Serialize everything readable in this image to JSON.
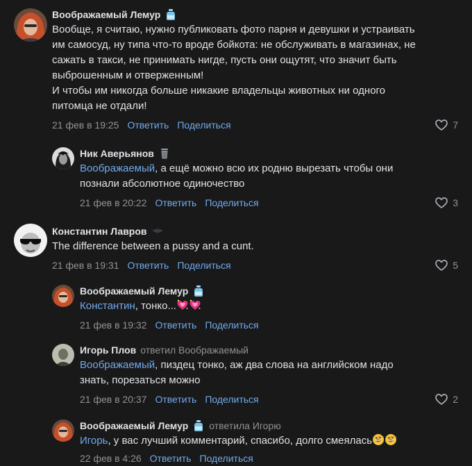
{
  "comments": [
    {
      "author": "Воображаемый Лемур",
      "lines": [
        "Вообще, я считаю, нужно публиковать фото парня и девушки и устраивать",
        "им самосуд, ну типа что-то вроде бойкота: не обслуживать в магазинах, не",
        "сажать в такси, не принимать нигде, пусть они ощутят, что значит быть",
        "выброшенным и отверженным!",
        "И чтобы им никогда больше никакие владельцы животных ни одного",
        "питомца не отдали!"
      ],
      "date": "21 фев в 19:25",
      "reply": "Ответить",
      "share": "Поделиться",
      "likes": "7"
    },
    {
      "author": "Ник Аверьянов",
      "mention": "Воображаемый",
      "line1": ", а ещё можно всю их родню вырезать чтобы они",
      "line2": "познали абсолютное одиночество",
      "date": "21 фев в 20:22",
      "reply": "Ответить",
      "share": "Поделиться",
      "likes": "3"
    },
    {
      "author": "Константин Лавров",
      "text": "The difference between a pussy and a cunt.",
      "date": "21 фев в 19:31",
      "reply": "Ответить",
      "share": "Поделиться",
      "likes": "5"
    },
    {
      "author": "Воображаемый Лемур",
      "mention": "Константин",
      "text": ", тонко...",
      "date": "21 фев в 19:32",
      "reply": "Ответить",
      "share": "Поделиться"
    },
    {
      "author": "Игорь Плов",
      "replied_to": "ответил Воображаемый",
      "mention": "Воображаемый",
      "line1": ", пиздец тонко, аж два слова на английском надо",
      "line2": "знать, порезаться можно",
      "date": "21 фев в 20:37",
      "reply": "Ответить",
      "share": "Поделиться",
      "likes": "2"
    },
    {
      "author": "Воображаемый Лемур",
      "replied_to": "ответила Игорю",
      "mention": "Игорь",
      "text": ", у вас лучший комментарий, спасибо, долго смеялась",
      "date": "22 фев в 4:26",
      "reply": "Ответить",
      "share": "Поделиться"
    }
  ],
  "colors": {
    "background": "#19191a",
    "text": "#e1e3e6",
    "secondary": "#939393",
    "link": "#71aaeb"
  },
  "icons": {
    "like": "heart-outline-icon",
    "badge_lemur": "water-bottle-icon",
    "badge_nik": "trash-can-icon",
    "badge_konstantin": "bat-icon",
    "emoji_hearts": "sparkling-heart-emoji",
    "emoji_laugh": "rolling-laughing-emoji"
  }
}
